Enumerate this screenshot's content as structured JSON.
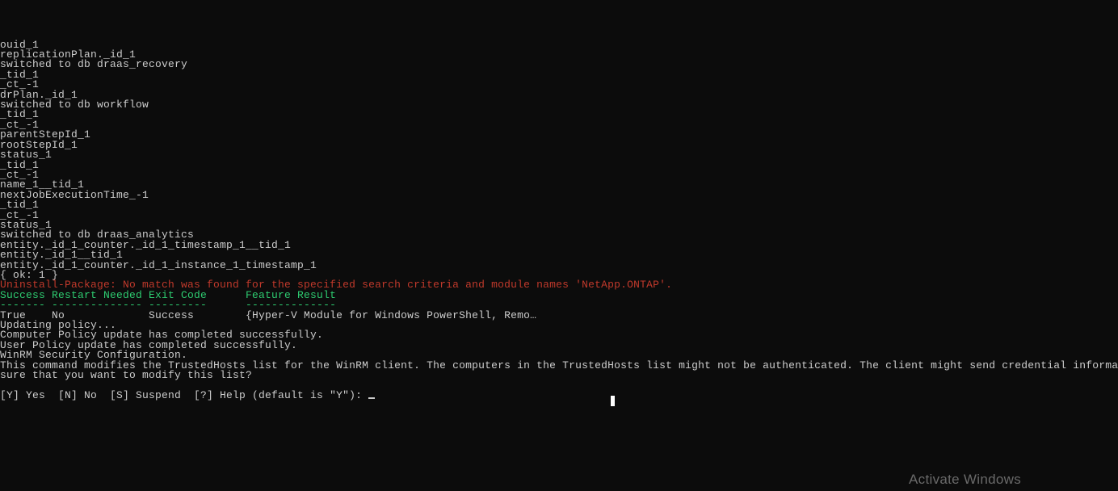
{
  "terminal": {
    "lines": [
      {
        "text": "ouid_1",
        "class": "default"
      },
      {
        "text": "replicationPlan._id_1",
        "class": "default"
      },
      {
        "text": "switched to db draas_recovery",
        "class": "default"
      },
      {
        "text": "_tid_1",
        "class": "default"
      },
      {
        "text": "_ct_-1",
        "class": "default"
      },
      {
        "text": "drPlan._id_1",
        "class": "default"
      },
      {
        "text": "switched to db workflow",
        "class": "default"
      },
      {
        "text": "_tid_1",
        "class": "default"
      },
      {
        "text": "_ct_-1",
        "class": "default"
      },
      {
        "text": "parentStepId_1",
        "class": "default"
      },
      {
        "text": "rootStepId_1",
        "class": "default"
      },
      {
        "text": "status_1",
        "class": "default"
      },
      {
        "text": "_tid_1",
        "class": "default"
      },
      {
        "text": "_ct_-1",
        "class": "default"
      },
      {
        "text": "name_1__tid_1",
        "class": "default"
      },
      {
        "text": "nextJobExecutionTime_-1",
        "class": "default"
      },
      {
        "text": "_tid_1",
        "class": "default"
      },
      {
        "text": "_ct_-1",
        "class": "default"
      },
      {
        "text": "status_1",
        "class": "default"
      },
      {
        "text": "switched to db draas_analytics",
        "class": "default"
      },
      {
        "text": "entity._id_1_counter._id_1_timestamp_1__tid_1",
        "class": "default"
      },
      {
        "text": "entity._id_1__tid_1",
        "class": "default"
      },
      {
        "text": "entity._id_1_counter._id_1_instance_1_timestamp_1",
        "class": "default"
      },
      {
        "text": "{ ok: 1 }",
        "class": "default"
      },
      {
        "text": "Uninstall-Package: No match was found for the specified search criteria and module names 'NetApp.ONTAP'.",
        "class": "red"
      },
      {
        "text": "",
        "class": "default"
      },
      {
        "text": "Success Restart Needed Exit Code      Feature Result",
        "class": "green"
      },
      {
        "text": "------- -------------- ---------      --------------",
        "class": "green"
      },
      {
        "text": "True    No             Success        {Hyper-V Module for Windows PowerShell, Remo…",
        "class": "default"
      },
      {
        "text": "",
        "class": "default"
      },
      {
        "text": "Updating policy...",
        "class": "default"
      },
      {
        "text": "",
        "class": "default"
      },
      {
        "text": "Computer Policy update has completed successfully.",
        "class": "default"
      },
      {
        "text": "User Policy update has completed successfully.",
        "class": "default"
      },
      {
        "text": "",
        "class": "default"
      },
      {
        "text": "",
        "class": "default"
      },
      {
        "text": "WinRM Security Configuration.",
        "class": "default"
      },
      {
        "text": "This command modifies the TrustedHosts list for the WinRM client. The computers in the TrustedHosts list might not be authenticated. The client might send credential information to these computers. Are you",
        "class": "default"
      },
      {
        "text": "sure that you want to modify this list?",
        "class": "default"
      }
    ],
    "prompt": "[Y] Yes  [N] No  [S] Suspend  [?] Help (default is \"Y\"): "
  },
  "watermark": "Activate Windows"
}
